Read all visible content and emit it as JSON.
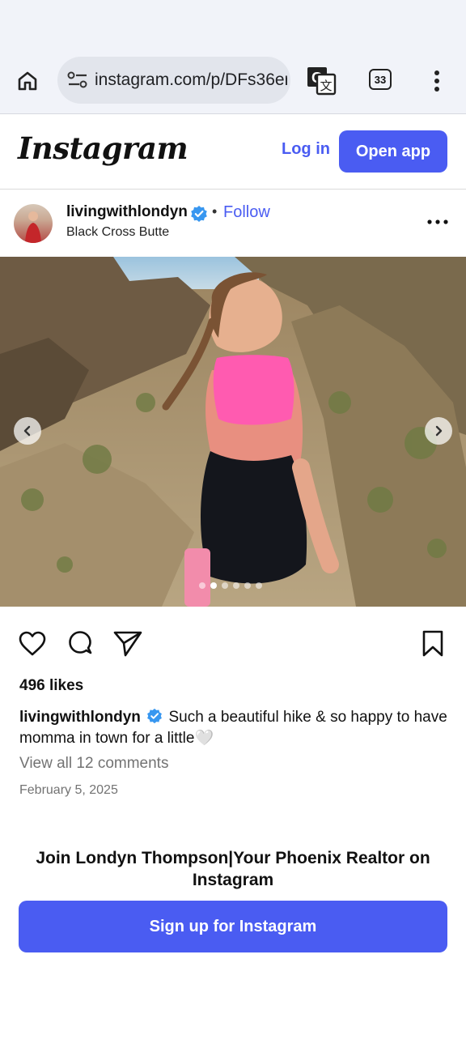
{
  "browser": {
    "url": "instagram.com/p/DFs36er",
    "tab_count": "33",
    "icons": {
      "home": "home-icon",
      "site_settings": "tune-icon",
      "translate": "translate-icon",
      "menu": "more-vertical-icon"
    }
  },
  "header": {
    "logo": "Instagram",
    "login_label": "Log in",
    "open_app_label": "Open app",
    "accent_color": "#4a5cf2"
  },
  "post": {
    "username": "livingwithlondyn",
    "follow_label": "Follow",
    "location": "Black Cross Butte",
    "carousel": {
      "slide_count": 6,
      "active_index": 1
    },
    "likes": "496 likes",
    "caption_user": "livingwithlondyn",
    "caption_text": "Such a beautiful hike & so happy to have momma in town for a little🤍",
    "view_comments": "View all 12 comments",
    "date": "February 5, 2025"
  },
  "footer": {
    "join_title": "Join Londyn Thompson|Your Phoenix Realtor on Instagram",
    "signup_label": "Sign up for Instagram"
  }
}
